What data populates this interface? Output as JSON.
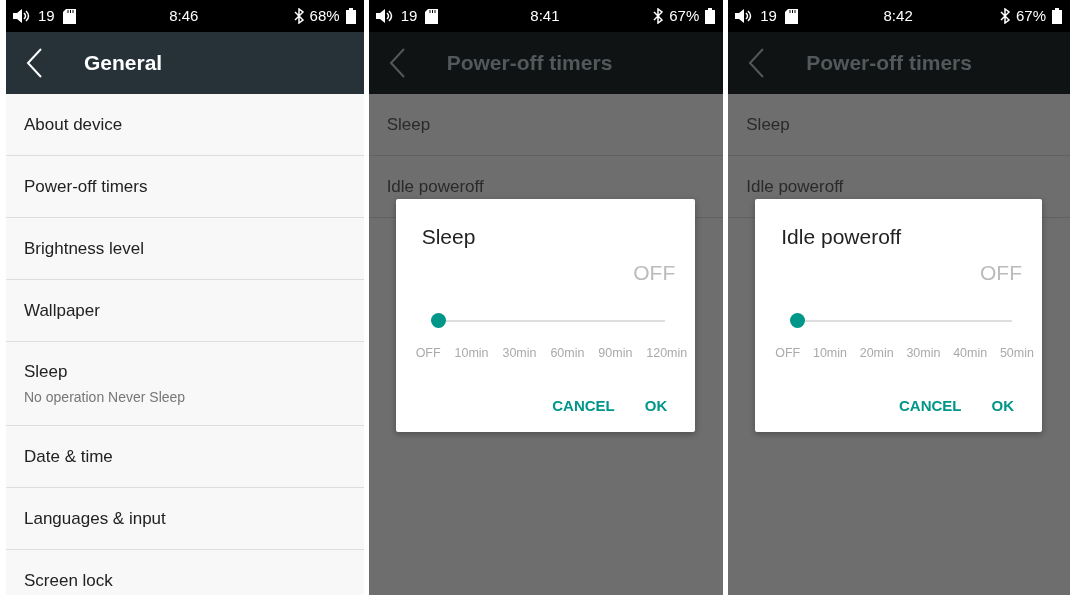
{
  "screens": [
    {
      "status": {
        "volume": "19",
        "time": "8:46",
        "battery": "68%"
      },
      "header": {
        "title": "General"
      },
      "items": [
        {
          "title": "About device"
        },
        {
          "title": "Power-off timers"
        },
        {
          "title": "Brightness level"
        },
        {
          "title": "Wallpaper"
        },
        {
          "title": "Sleep",
          "subtitle": "No operation Never Sleep"
        },
        {
          "title": "Date & time"
        },
        {
          "title": "Languages & input"
        },
        {
          "title": "Screen lock"
        }
      ]
    },
    {
      "status": {
        "volume": "19",
        "time": "8:41",
        "battery": "67%"
      },
      "header": {
        "title": "Power-off timers"
      },
      "items": [
        {
          "title": "Sleep"
        },
        {
          "title": "Idle poweroff"
        }
      ],
      "dialog": {
        "title": "Sleep",
        "value": "OFF",
        "level": 0,
        "ticks": [
          "OFF",
          "10min",
          "30min",
          "60min",
          "90min",
          "120min"
        ],
        "buttons": [
          "CANCEL",
          "OK"
        ]
      }
    },
    {
      "status": {
        "volume": "19",
        "time": "8:42",
        "battery": "67%"
      },
      "header": {
        "title": "Power-off timers"
      },
      "items": [
        {
          "title": "Sleep"
        },
        {
          "title": "Idle poweroff"
        }
      ],
      "dialog": {
        "title": "Idle poweroff",
        "value": "OFF",
        "level": 0,
        "ticks": [
          "OFF",
          "10min",
          "20min",
          "30min",
          "40min",
          "50min"
        ],
        "buttons": [
          "CANCEL",
          "OK"
        ]
      }
    }
  ]
}
